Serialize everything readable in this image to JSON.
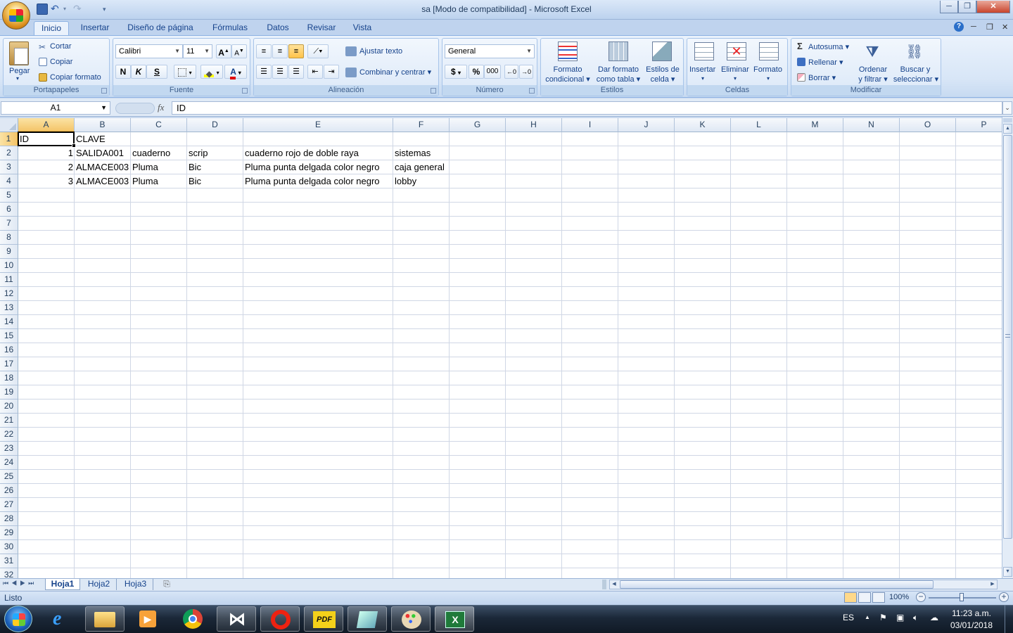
{
  "window": {
    "title": "sa  [Modo de compatibilidad] - Microsoft Excel"
  },
  "tabs": [
    "Inicio",
    "Insertar",
    "Diseño de página",
    "Fórmulas",
    "Datos",
    "Revisar",
    "Vista"
  ],
  "ribbon": {
    "portapapeles": {
      "paste": "Pegar",
      "cut": "Cortar",
      "copy": "Copiar",
      "format_painter": "Copiar formato",
      "label": "Portapapeles"
    },
    "fuente": {
      "font": "Calibri",
      "size": "11",
      "bold": "N",
      "italic": "K",
      "underline": "S",
      "label": "Fuente"
    },
    "alineacion": {
      "wrap": "Ajustar texto",
      "merge": "Combinar y centrar",
      "label": "Alineación"
    },
    "numero": {
      "format": "General",
      "currency": "$",
      "percent": "%",
      "thousands": "000",
      "label": "Número"
    },
    "estilos": {
      "cond_1": "Formato",
      "cond_2": "condicional",
      "table_1": "Dar formato",
      "table_2": "como tabla",
      "cell_1": "Estilos de",
      "cell_2": "celda",
      "label": "Estilos"
    },
    "celdas": {
      "insert": "Insertar",
      "delete": "Eliminar",
      "format": "Formato",
      "label": "Celdas"
    },
    "modificar": {
      "autosum": "Autosuma",
      "fill": "Rellenar",
      "clear": "Borrar",
      "sort_1": "Ordenar",
      "sort_2": "y filtrar",
      "find_1": "Buscar y",
      "find_2": "seleccionar",
      "label": "Modificar"
    }
  },
  "formula_bar": {
    "name_box": "A1",
    "fx": "fx",
    "content": "ID"
  },
  "columns": [
    "A",
    "B",
    "C",
    "D",
    "E",
    "F",
    "G",
    "H",
    "I",
    "J",
    "K",
    "L",
    "M",
    "N",
    "O",
    "P"
  ],
  "rows": [
    "1",
    "2",
    "3",
    "4",
    "5",
    "6",
    "7",
    "8",
    "9",
    "10",
    "11",
    "12",
    "13",
    "14",
    "15",
    "16",
    "17",
    "18",
    "19",
    "20",
    "21",
    "22",
    "23",
    "24",
    "25",
    "26",
    "27",
    "28",
    "29",
    "30",
    "31",
    "32"
  ],
  "cells": [
    [
      "ID",
      "CLAVE",
      "",
      "",
      "",
      ""
    ],
    [
      "1",
      "SALIDA001",
      "cuaderno",
      "scrip",
      "cuaderno rojo de doble raya",
      "sistemas"
    ],
    [
      "2",
      "ALMACE003",
      "Pluma",
      "Bic",
      "Pluma punta delgada color negro",
      "caja general"
    ],
    [
      "3",
      "ALMACE003",
      "Pluma",
      "Bic",
      "Pluma punta delgada color negro",
      "lobby"
    ]
  ],
  "sheets": [
    "Hoja1",
    "Hoja2",
    "Hoja3"
  ],
  "status": {
    "text": "Listo",
    "zoom": "100%"
  },
  "taskbar": {
    "lang": "ES",
    "time": "11:23 a.m.",
    "date": "03/01/2018"
  }
}
